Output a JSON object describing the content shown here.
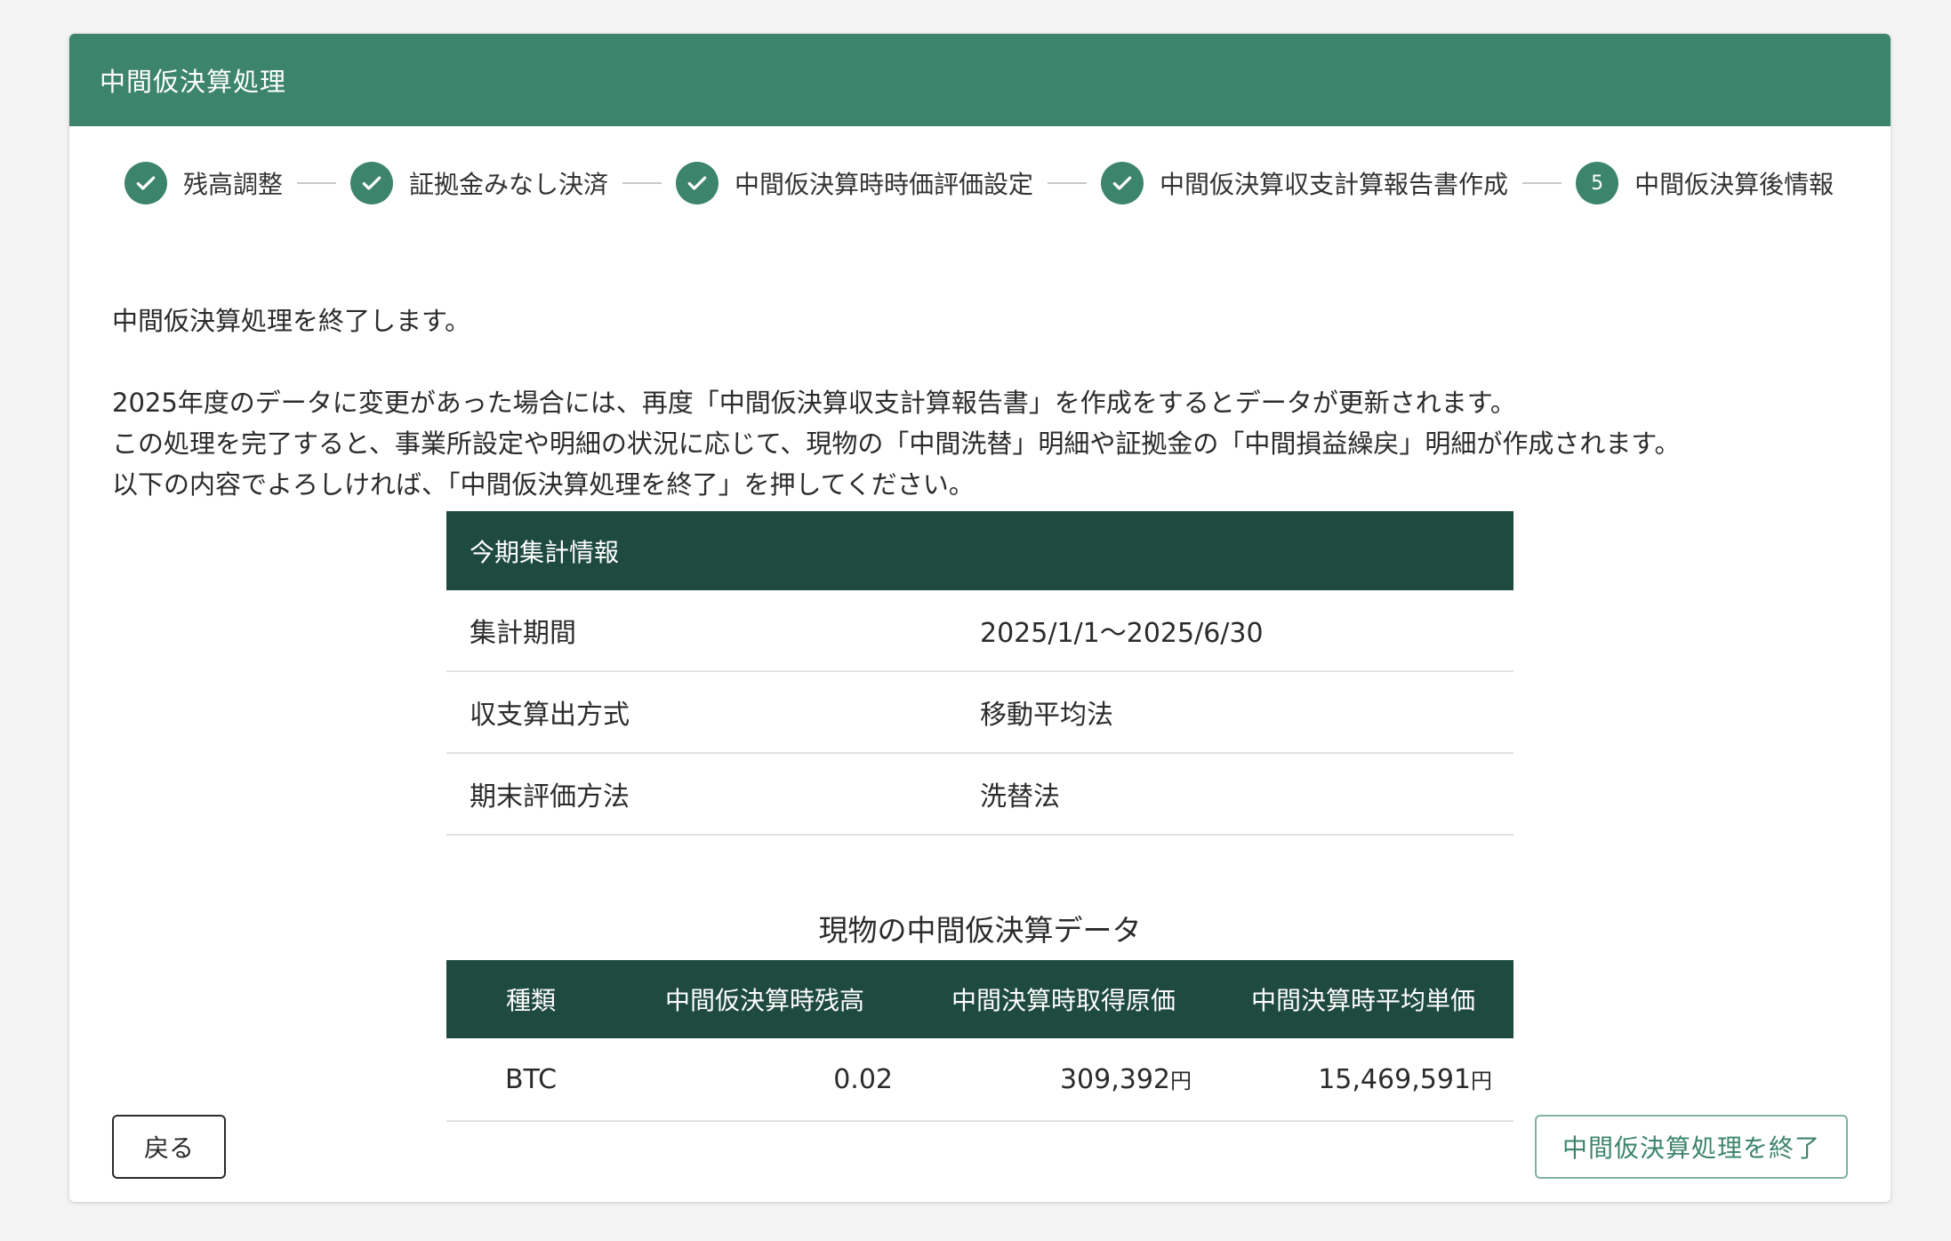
{
  "header": {
    "title": "中間仮決算処理"
  },
  "stepper": {
    "steps": [
      {
        "label": "残高調整",
        "state": "done"
      },
      {
        "label": "証拠金みなし決済",
        "state": "done"
      },
      {
        "label": "中間仮決算時時価評価設定",
        "state": "done"
      },
      {
        "label": "中間仮決算収支計算報告書作成",
        "state": "done"
      },
      {
        "label": "中間仮決算後情報",
        "state": "current",
        "number": "5"
      }
    ]
  },
  "intro": {
    "line1": "中間仮決算処理を終了します。",
    "line2": "2025年度のデータに変更があった場合には、再度「中間仮決算収支計算報告書」を作成をするとデータが更新されます。",
    "line3": "この処理を完了すると、事業所設定や明細の状況に応じて、現物の「中間洗替」明細や証拠金の「中間損益繰戻」明細が作成されます。",
    "line4": "以下の内容でよろしければ、「中間仮決算処理を終了」を押してください。"
  },
  "summary": {
    "heading": "今期集計情報",
    "rows": [
      {
        "label": "集計期間",
        "value": "2025/1/1〜2025/6/30"
      },
      {
        "label": "収支算出方式",
        "value": "移動平均法"
      },
      {
        "label": "期末評価方法",
        "value": "洗替法"
      }
    ]
  },
  "spot": {
    "title": "現物の中間仮決算データ",
    "columns": [
      "種類",
      "中間仮決算時残高",
      "中間決算時取得原価",
      "中間決算時平均単価"
    ],
    "rows": [
      {
        "type": "BTC",
        "balance": "0.02",
        "cost": "309,392",
        "avg_price": "15,469,591",
        "unit": "円"
      }
    ]
  },
  "buttons": {
    "back": "戻る",
    "finish": "中間仮決算処理を終了"
  },
  "colors": {
    "primary": "#3d846c",
    "table_header": "#1f4a3f"
  },
  "icons": {
    "done": "check-icon"
  }
}
